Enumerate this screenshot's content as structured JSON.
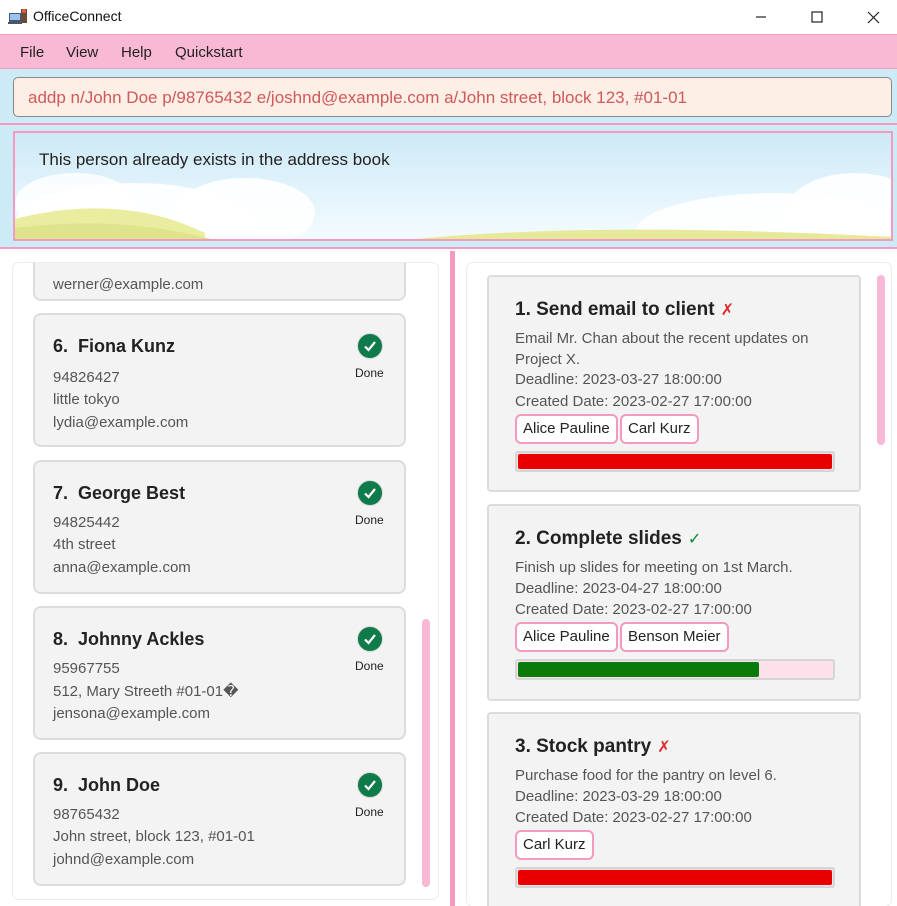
{
  "window": {
    "title": "OfficeConnect",
    "minimize": "—",
    "maximize": "☐",
    "close": "✕"
  },
  "menu": [
    "File",
    "View",
    "Help",
    "Quickstart"
  ],
  "command": {
    "value": "addp n/John Doe p/98765432 e/joshnd@example.com a/John street, block 123, #01-01"
  },
  "result": {
    "message": "This person already exists in the address book"
  },
  "persons": [
    {
      "email": "werner@example.com"
    },
    {
      "index": "6.",
      "name": "Fiona Kunz",
      "phone": "94826427",
      "address": "little tokyo",
      "email": "lydia@example.com",
      "status": "Done"
    },
    {
      "index": "7.",
      "name": "George Best",
      "phone": "94825442",
      "address": "4th street",
      "email": "anna@example.com",
      "status": "Done"
    },
    {
      "index": "8.",
      "name": "Johnny Ackles",
      "phone": "95967755",
      "address": "512, Mary Streeth #01-01�",
      "email": "jensona@example.com",
      "status": "Done"
    },
    {
      "index": "9.",
      "name": "John Doe",
      "phone": "98765432",
      "address": "John street, block 123, #01-01",
      "email": "johnd@example.com",
      "status": "Done"
    }
  ],
  "tasks": [
    {
      "title": "1.  Send email to client",
      "mark": "✗",
      "desc": "Email Mr. Chan about the recent updates on Project X.",
      "deadline": "Deadline: 2023-03-27 18:00:00",
      "created": "Created Date: 2023-02-27 17:00:00",
      "tags": [
        "Alice Pauline",
        "Carl Kurz"
      ],
      "progress": 1.0,
      "bar_color": "#e80000"
    },
    {
      "title": "2.  Complete slides",
      "mark": "✓",
      "desc": "Finish up slides for meeting on 1st March.",
      "deadline": "Deadline: 2023-04-27 18:00:00",
      "created": "Created Date: 2023-02-27 17:00:00",
      "tags": [
        "Alice Pauline",
        "Benson Meier"
      ],
      "progress": 0.77,
      "bar_color": "#0a7a0a"
    },
    {
      "title": "3.  Stock pantry",
      "mark": "✗",
      "desc": "Purchase food for the pantry on level 6.",
      "deadline": "Deadline: 2023-03-29 18:00:00",
      "created": "Created Date: 2023-02-27 17:00:00",
      "tags": [
        "Carl Kurz"
      ],
      "progress": 1.0,
      "bar_color": "#e80000"
    }
  ],
  "colors": {
    "accent_pink": "#f49ac0",
    "menu_bg": "#f9b8d3",
    "panel_bg": "#cdeaf7",
    "done_green": "#0f7a4a"
  }
}
